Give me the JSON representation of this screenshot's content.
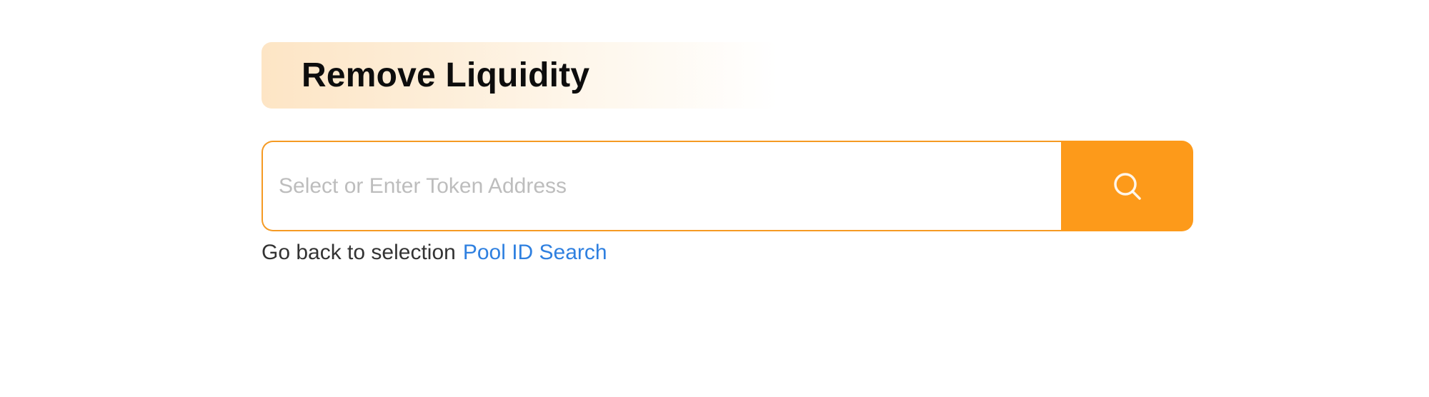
{
  "header": {
    "title": "Remove Liquidity"
  },
  "search": {
    "placeholder": "Select or Enter Token Address",
    "value": "",
    "button_icon": "search-icon"
  },
  "navigation": {
    "back_text": "Go back to selection",
    "link_label": "Pool ID Search"
  },
  "colors": {
    "accent": "#fd9a1a",
    "input_border": "#f59a23",
    "link": "#2f80e0",
    "title_banner_start": "#fde5c5"
  }
}
